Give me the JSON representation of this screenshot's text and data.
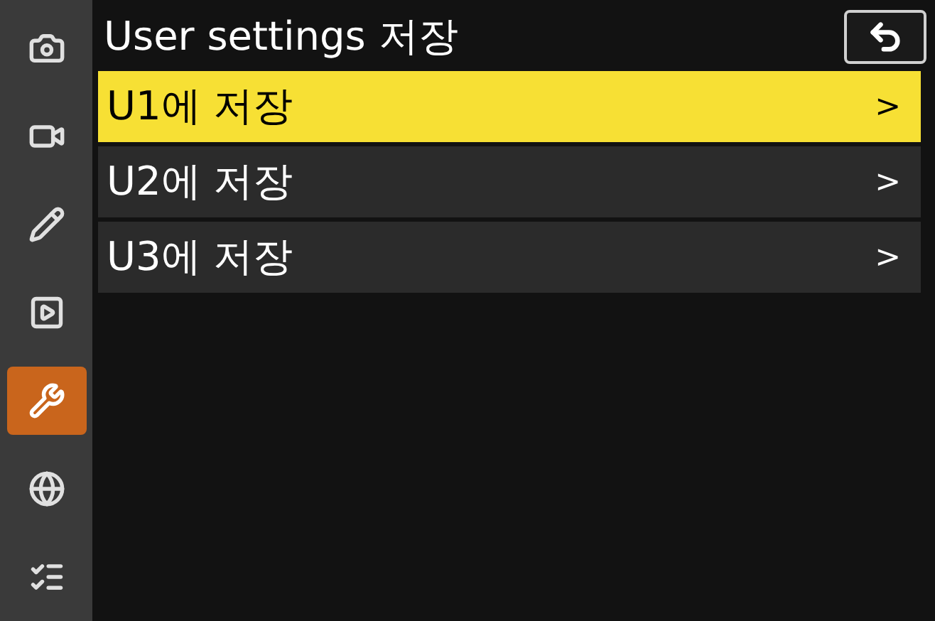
{
  "title": "User settings 저장",
  "sidebar": {
    "items": [
      {
        "kind": "camera",
        "selected": false
      },
      {
        "kind": "movie",
        "selected": false
      },
      {
        "kind": "pencil",
        "selected": false
      },
      {
        "kind": "playback",
        "selected": false
      },
      {
        "kind": "wrench",
        "selected": true
      },
      {
        "kind": "network",
        "selected": false
      },
      {
        "kind": "list",
        "selected": false
      }
    ]
  },
  "items": [
    {
      "label": "U1에 저장",
      "arrow": ">",
      "selected": true
    },
    {
      "label": "U2에 저장",
      "arrow": ">",
      "selected": false
    },
    {
      "label": "U3에 저장",
      "arrow": ">",
      "selected": false
    }
  ]
}
